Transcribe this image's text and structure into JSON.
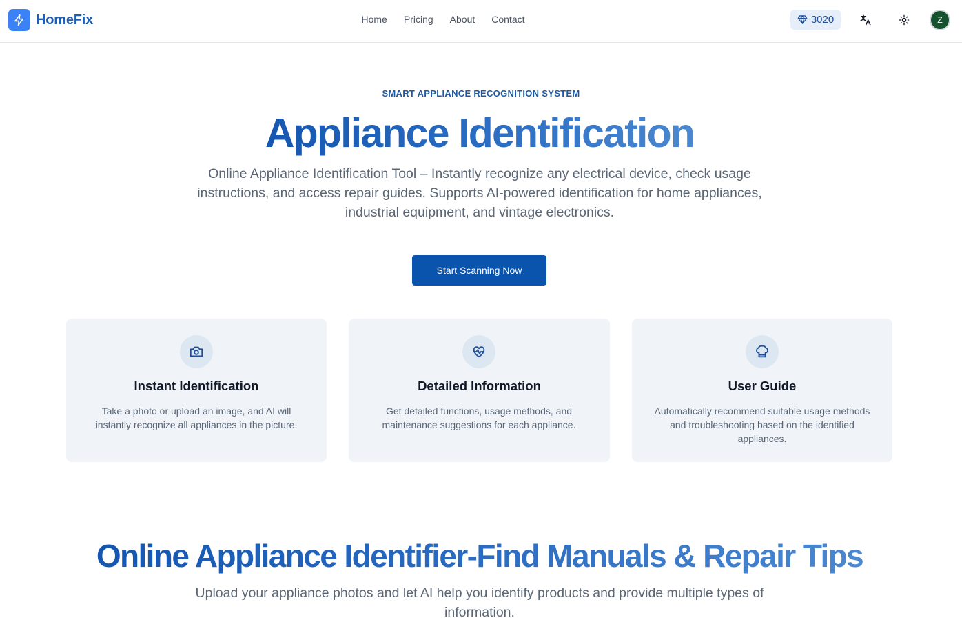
{
  "nav": {
    "brand": "HomeFix",
    "links": [
      {
        "label": "Home"
      },
      {
        "label": "Pricing"
      },
      {
        "label": "About"
      },
      {
        "label": "Contact"
      }
    ],
    "credits": "3020",
    "avatar_initial": "Z",
    "icons": {
      "logo": "lightning-icon",
      "credits": "diamond-icon",
      "language": "translate-icon",
      "theme": "sun-icon"
    }
  },
  "hero": {
    "eyebrow": "SMART APPLIANCE RECOGNITION SYSTEM",
    "title": "Appliance Identification",
    "subtitle": "Online Appliance Identification Tool – Instantly recognize any electrical device, check usage instructions, and access repair guides. Supports AI-powered identification for home appliances, industrial equipment, and vintage electronics.",
    "cta_label": "Start Scanning Now"
  },
  "features": [
    {
      "icon": "camera-icon",
      "title": "Instant Identification",
      "description": "Take a photo or upload an image, and AI will instantly recognize all appliances in the picture."
    },
    {
      "icon": "heart-pulse-icon",
      "title": "Detailed Information",
      "description": "Get detailed functions, usage methods, and maintenance suggestions for each appliance."
    },
    {
      "icon": "chef-hat-icon",
      "title": "User Guide",
      "description": "Automatically recommend suitable usage methods and troubleshooting based on the identified appliances."
    }
  ],
  "section": {
    "title": "Online Appliance Identifier-Find Manuals & Repair Tips",
    "subtitle": "Upload your appliance photos and let AI help you identify products and provide multiple types of information."
  },
  "colors": {
    "primary": "#0b54ad",
    "brand": "#1e5fb3",
    "logo_bg": "#3b82f6",
    "card_bg": "#f0f4f8",
    "avatar_bg": "#14532d"
  }
}
